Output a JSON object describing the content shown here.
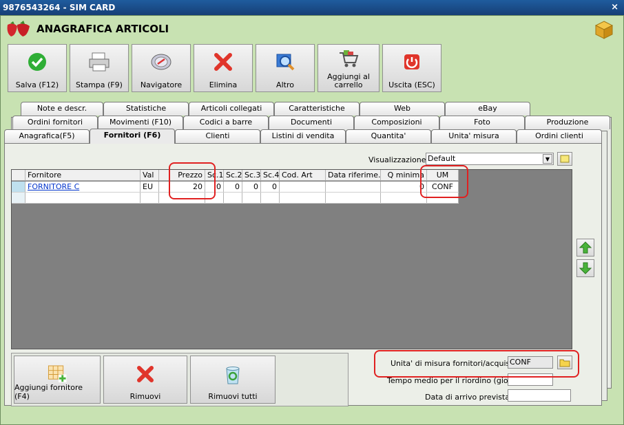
{
  "window": {
    "title": "9876543264 - SIM CARD",
    "close": "×"
  },
  "header": {
    "title": "ANAGRAFICA ARTICOLI"
  },
  "toolbar": {
    "save": "Salva (F12)",
    "print": "Stampa (F9)",
    "navigator": "Navigatore",
    "delete": "Elimina",
    "other": "Altro",
    "add_cart": "Aggiungi al carrello",
    "exit": "Uscita (ESC)"
  },
  "tabs": {
    "row1": [
      "Note e descr.",
      "Statistiche",
      "Articoli collegati",
      "Caratteristiche",
      "Web",
      "eBay"
    ],
    "row2": [
      "Ordini fornitori",
      "Movimenti (F10)",
      "Codici a barre",
      "Documenti",
      "Composizioni",
      "Foto",
      "Produzione"
    ],
    "row3": [
      "Anagrafica(F5)",
      "Fornitori (F6)",
      "Clienti",
      "Listini di vendita",
      "Quantita'",
      "Unita' misura",
      "Ordini clienti"
    ]
  },
  "view": {
    "label": "Visualizzazione :",
    "value": "Default"
  },
  "table": {
    "headers": [
      "Fornitore",
      "Val",
      "Prezzo",
      "Sc.1",
      "Sc.2",
      "Sc.3",
      "Sc.4",
      "Cod. Art",
      "Data riferime...",
      "Q minima",
      "UM"
    ],
    "rows": [
      {
        "fornitore": "FORNITORE C",
        "val": "EU",
        "prezzo": "20",
        "sc1": "0",
        "sc2": "0",
        "sc3": "0",
        "sc4": "0",
        "cod": "",
        "data": "",
        "qmin": "0",
        "um": "CONF"
      }
    ]
  },
  "bottom": {
    "add_supplier": "Aggiungi fornitore (F4)",
    "remove": "Rimuovi",
    "remove_all": "Rimuovi tutti"
  },
  "fields": {
    "um_label": "Unita' di misura fornitori/acquisto :",
    "um_value": "CONF",
    "tempo_label": "Tempo medio per il riordino (giorni) :",
    "tempo_value": "",
    "arrivo_label": "Data di arrivo prevista :",
    "arrivo_value": ""
  },
  "colors": {
    "background": "#c8e2b2",
    "titlebar": "#1f5c9e",
    "highlight": "#e02020"
  }
}
